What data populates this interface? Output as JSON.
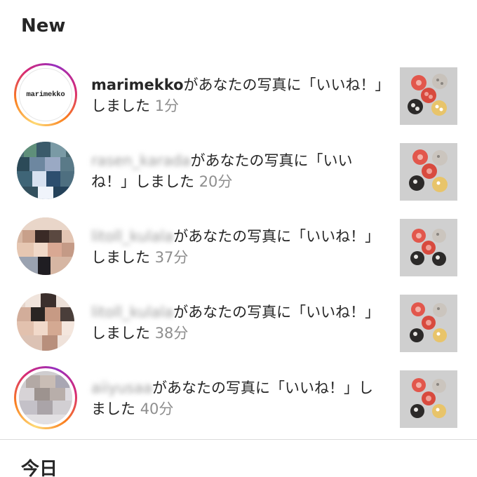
{
  "sections": {
    "new_title": "New",
    "today_title": "今日"
  },
  "notifications": [
    {
      "username": "marimekko",
      "username_blurred": false,
      "message": "があなたの写真に「いいね！」しました",
      "time": "1分",
      "avatar_logo_text": "marimekko",
      "avatar_ring": true,
      "thumbnail": "photo-thumbnail"
    },
    {
      "username": "rasen_karada",
      "username_blurred": true,
      "message": "があなたの写真に「いいね！」しました",
      "time": "20分",
      "avatar_ring": false,
      "thumbnail": "photo-thumbnail"
    },
    {
      "username": "litoll_kulala",
      "username_blurred": true,
      "message": "があなたの写真に「いいね！」しました",
      "time": "37分",
      "avatar_ring": false,
      "thumbnail": "photo-thumbnail"
    },
    {
      "username": "litoll_kulala",
      "username_blurred": true,
      "message": "があなたの写真に「いいね！」しました",
      "time": "38分",
      "avatar_ring": false,
      "thumbnail": "photo-thumbnail"
    },
    {
      "username": "aiiyusaa",
      "username_blurred": true,
      "message": "があなたの写真に「いいね！」しました",
      "time": "40分",
      "avatar_ring": true,
      "thumbnail": "photo-thumbnail"
    }
  ],
  "colors": {
    "story_ring": [
      "#feda75",
      "#fa7e1e",
      "#d62976",
      "#962fbf"
    ],
    "text_primary": "#262626",
    "text_secondary": "#8e8e8e",
    "divider": "#dbdbdb"
  }
}
